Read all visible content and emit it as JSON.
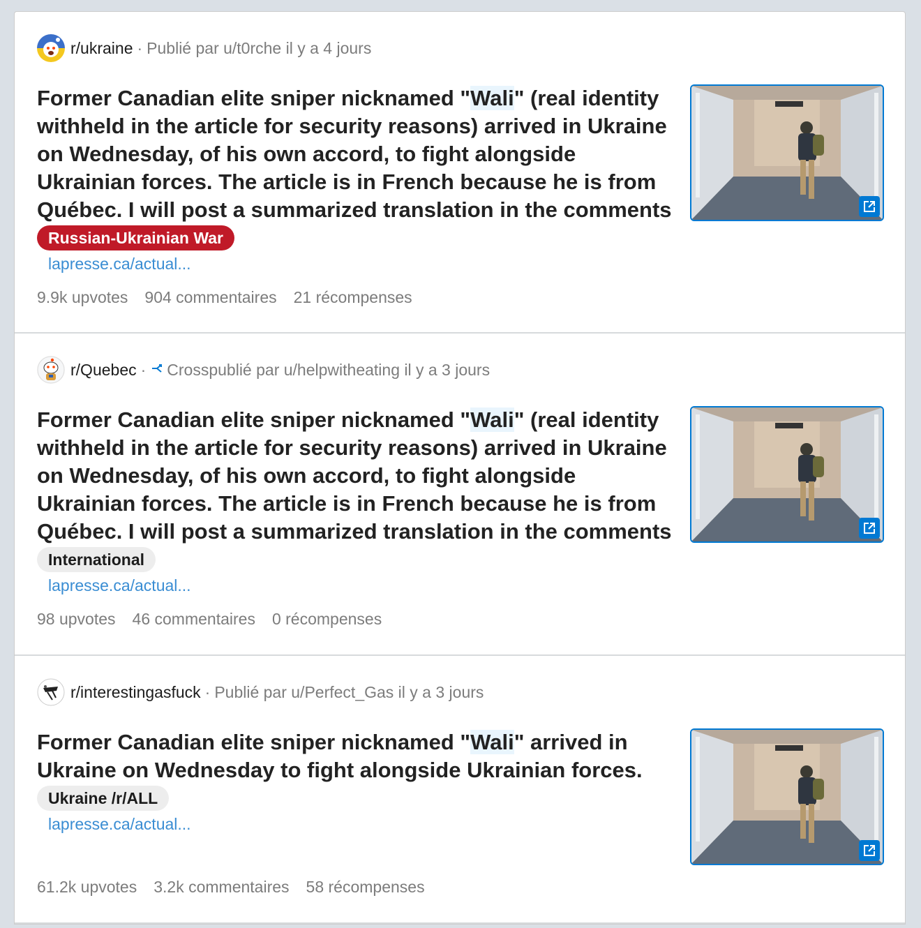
{
  "posts": [
    {
      "subreddit": "r/ukraine",
      "byline": "Publié par u/t0rche il y a 4 jours",
      "crosspost": false,
      "title_before": "Former Canadian elite sniper nicknamed \"",
      "title_highlight": "Wali",
      "title_after": "\" (real identity withheld in the article for security reasons) arrived in Ukraine on Wednesday, of his own accord, to fight alongside Ukrainian forces. The article is in French because he is from Québec. I will post a summarized translation in the comments",
      "flair": "Russian-Ukrainian War",
      "link": "lapresse.ca/actual...",
      "upvotes": "9.9k upvotes",
      "comments": "904 commentaires",
      "awards": "21 récompenses"
    },
    {
      "subreddit": "r/Quebec",
      "byline": "Crosspublié par u/helpwitheating il y a 3 jours",
      "crosspost": true,
      "title_before": "Former Canadian elite sniper nicknamed \"",
      "title_highlight": "Wali",
      "title_after": "\" (real identity withheld in the article for security reasons) arrived in Ukraine on Wednesday, of his own accord, to fight alongside Ukrainian forces. The article is in French because he is from Québec. I will post a summarized translation in the comments",
      "flair": "International",
      "link": "lapresse.ca/actual...",
      "upvotes": "98 upvotes",
      "comments": "46 commentaires",
      "awards": "0 récompenses"
    },
    {
      "subreddit": "r/interestingasfuck",
      "byline": "Publié par u/Perfect_Gas il y a 3 jours",
      "crosspost": false,
      "title_before": "Former Canadian elite sniper nicknamed \"",
      "title_highlight": "Wali",
      "title_after": "\" arrived in Ukraine on Wednesday to fight alongside Ukrainian forces.",
      "flair": "Ukraine /r/ALL",
      "link": "lapresse.ca/actual...",
      "upvotes": "61.2k upvotes",
      "comments": "3.2k commentaires",
      "awards": "58 récompenses"
    }
  ],
  "colors": {
    "accent": "#0079d3",
    "flair_red": "#c01a28",
    "link": "#3a8dd3"
  },
  "icons": {
    "external_link": "external-link-icon",
    "crosspost": "crosspost-icon"
  }
}
